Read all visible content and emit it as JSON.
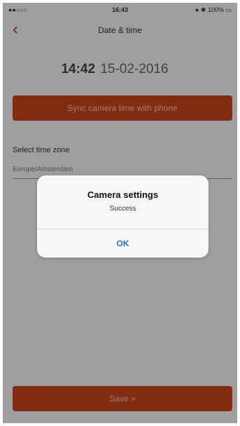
{
  "status_bar": {
    "carrier": "●●○○○",
    "time": "16:43",
    "battery": "● ✱ 100% ▭"
  },
  "nav": {
    "back_icon": "chevron-left-icon",
    "title": "Date & time"
  },
  "datetime": {
    "time": "14:42",
    "date": "15-02-2016"
  },
  "sync_button_label": "Sync camera time with phone",
  "timezone": {
    "label": "Select time zone",
    "value": "Europe/Amsterdam"
  },
  "save_button_label": "Save »",
  "dialog": {
    "title": "Camera settings",
    "message": "Success",
    "ok_label": "OK"
  },
  "colors": {
    "accent": "#c8441c",
    "dialog_ok": "#2f6fd6"
  }
}
